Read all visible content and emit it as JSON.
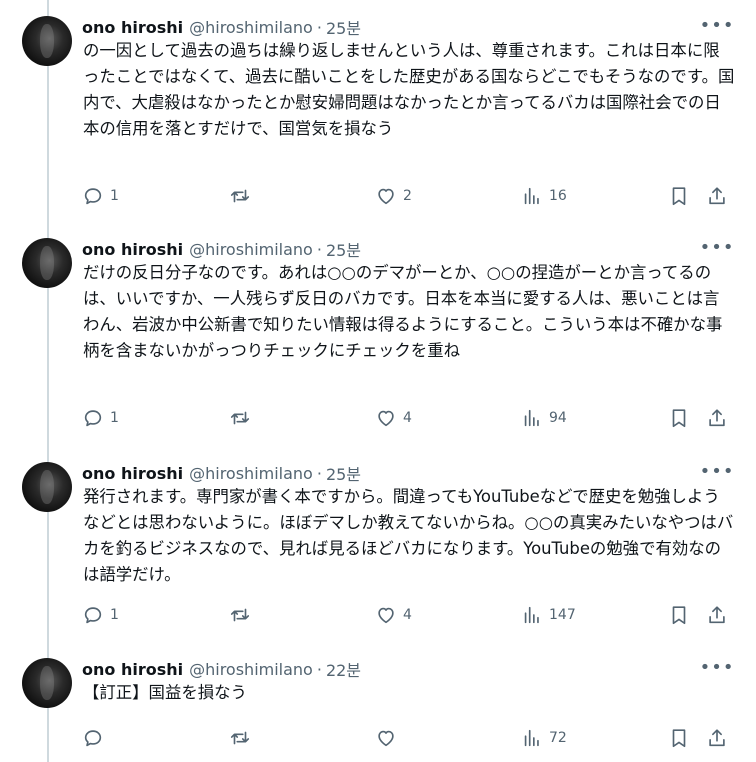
{
  "tweets": [
    {
      "name": "ono hiroshi",
      "handle": "@hiroshimilano",
      "separator": "·",
      "time": "25분",
      "text": "の一因として過去の過ちは繰り返しませんという人は、尊重されます。これは日本に限ったことではなくて、過去に酷いことをした歴史がある国ならどこでもそうなのです。国内で、大虐殺はなかったとか慰安婦問題はなかったとか言ってるバカは国際社会での日本の信用を落とすだけで、国営気を損なう",
      "replies": "1",
      "retweets": "",
      "likes": "2",
      "views": "16"
    },
    {
      "name": "ono hiroshi",
      "handle": "@hiroshimilano",
      "separator": "·",
      "time": "25분",
      "text": "だけの反日分子なのです。あれは○○のデマがーとか、○○の捏造がーとか言ってるのは、いいですか、一人残らず反日のバカです。日本を本当に愛する人は、悪いことは言わん、岩波か中公新書で知りたい情報は得るようにすること。こういう本は不確かな事柄を含まないかがっつりチェックにチェックを重ね",
      "replies": "1",
      "retweets": "",
      "likes": "4",
      "views": "94"
    },
    {
      "name": "ono hiroshi",
      "handle": "@hiroshimilano",
      "separator": "·",
      "time": "25분",
      "text": "発行されます。専門家が書く本ですから。間違ってもYouTubeなどで歴史を勉強しようなどとは思わないように。ほぼデマしか教えてないからね。○○の真実みたいなやつはバカを釣るビジネスなので、見れば見るほどバカになります。YouTubeの勉強で有効なのは語学だけ。",
      "replies": "1",
      "retweets": "",
      "likes": "4",
      "views": "147"
    },
    {
      "name": "ono hiroshi",
      "handle": "@hiroshimilano",
      "separator": "·",
      "time": "22분",
      "text": "【訂正】国益を損なう",
      "replies": "",
      "retweets": "",
      "likes": "",
      "views": "72"
    }
  ],
  "icons": {
    "more": "more-horizontal-icon",
    "reply": "reply-icon",
    "retweet": "retweet-icon",
    "like": "heart-icon",
    "views": "views-icon",
    "bookmark": "bookmark-icon",
    "share": "share-icon"
  },
  "colors": {
    "text": "#0f1419",
    "secondary": "#536471",
    "thread_line": "#cfd9de"
  }
}
